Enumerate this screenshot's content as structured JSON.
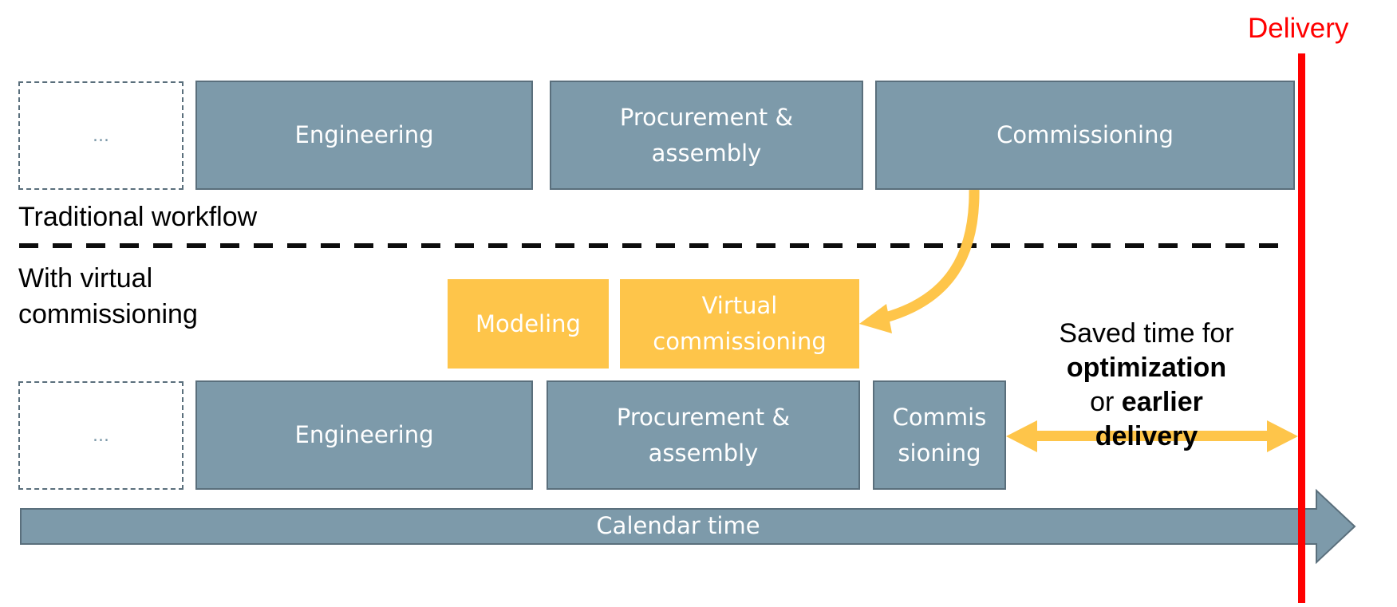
{
  "delivery": {
    "label": "Delivery",
    "color": "#ff0000"
  },
  "traditional": {
    "section_label": "Traditional workflow",
    "placeholder": "...",
    "phases": [
      {
        "label": "Engineering"
      },
      {
        "label": "Procurement & assembly"
      },
      {
        "label": "Commissioning"
      }
    ]
  },
  "virtual": {
    "section_label_line1": "With virtual",
    "section_label_line2": "commissioning",
    "placeholder": "...",
    "early_phases": [
      {
        "label": "Modeling"
      },
      {
        "label_line1": "Virtual",
        "label_line2": "commissioning"
      }
    ],
    "phases": [
      {
        "label": "Engineering"
      },
      {
        "label_line1": "Procurement &",
        "label_line2": "assembly"
      },
      {
        "label_line1": "Commis",
        "label_line2": "sioning"
      }
    ]
  },
  "traditional_procurement_line1": "Procurement &",
  "traditional_procurement_line2": "assembly",
  "saved_time": {
    "line1": "Saved time for",
    "line2_bold": "optimization",
    "line3_regular": "or ",
    "line3_bold": "earlier",
    "line4_bold": "delivery"
  },
  "timeline": {
    "label": "Calendar time"
  },
  "colors": {
    "phase_fill": "#7d9aaa",
    "phase_border": "#5a6f7c",
    "virtual_fill": "#fec54a",
    "separator": "#000000"
  }
}
